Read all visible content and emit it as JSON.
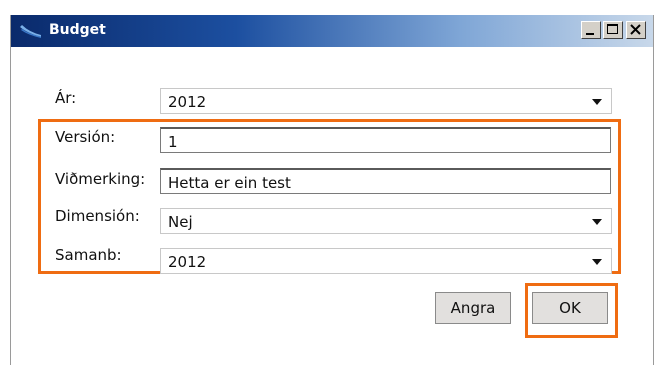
{
  "window": {
    "title": "Budget"
  },
  "title_buttons": {
    "icons": [
      "minimize-icon",
      "maximize-icon",
      "close-icon"
    ]
  },
  "form": {
    "year": {
      "label": "Ár:",
      "value": "2012"
    },
    "version": {
      "label": "Versión:",
      "value": "1"
    },
    "remark": {
      "label": "Viðmerking:",
      "value": "Hetta er ein test"
    },
    "dimension": {
      "label": "Dimensión:",
      "value": "Nej"
    },
    "compare": {
      "label": "Samanb:",
      "value": "2012"
    }
  },
  "buttons": {
    "cancel": "Angra",
    "ok": "OK"
  },
  "colors": {
    "highlight": "#ef6c12",
    "title_bar_start": "#0a2a6b",
    "title_bar_end": "#c8d8ea"
  }
}
